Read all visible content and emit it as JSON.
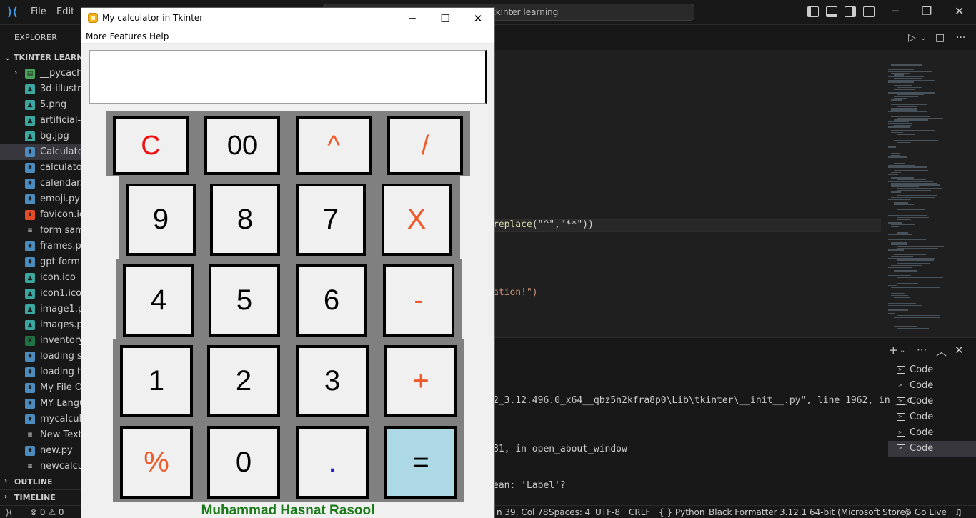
{
  "vscode": {
    "menu": [
      "File",
      "Edit"
    ],
    "command_center_text": "tkinter learning",
    "sidebar": {
      "title": "EXPLORER",
      "folder": "TKINTER LEARNING",
      "files": [
        {
          "label": "__pycache__",
          "type": "folder"
        },
        {
          "label": "3d-illustrat",
          "type": "image"
        },
        {
          "label": "5.png",
          "type": "image"
        },
        {
          "label": "artificial-In",
          "type": "image"
        },
        {
          "label": "bg.jpg",
          "type": "image"
        },
        {
          "label": "Calculator.p",
          "type": "python",
          "selected": true
        },
        {
          "label": "calculator.p",
          "type": "python"
        },
        {
          "label": "calendar.py",
          "type": "python"
        },
        {
          "label": "emoji.py",
          "type": "python"
        },
        {
          "label": "favicon.ico",
          "type": "star"
        },
        {
          "label": "form samp",
          "type": "text"
        },
        {
          "label": "frames.py",
          "type": "python"
        },
        {
          "label": "gpt form .p",
          "type": "python"
        },
        {
          "label": "icon.ico",
          "type": "image"
        },
        {
          "label": "icon1.ico",
          "type": "image"
        },
        {
          "label": "image1.pn",
          "type": "image"
        },
        {
          "label": "images.pn",
          "type": "image"
        },
        {
          "label": "inventory.x",
          "type": "excel"
        },
        {
          "label": "loading scr",
          "type": "python"
        },
        {
          "label": "loading tru",
          "type": "python"
        },
        {
          "label": "My File Or",
          "type": "python"
        },
        {
          "label": "MY Langu",
          "type": "python"
        },
        {
          "label": "mycalcula",
          "type": "python"
        },
        {
          "label": "New Text",
          "type": "text"
        },
        {
          "label": "new.py",
          "type": "python"
        },
        {
          "label": "newcalcul",
          "type": "text"
        }
      ],
      "sections": [
        "OUTLINE",
        "TIMELINE"
      ]
    },
    "editor": {
      "line1_fn": "replace",
      "line1_args": "(\"^\",\"**\")",
      "line1_close": ")",
      "line2": "ation!\")"
    },
    "terminal": {
      "lines": [
        "2_3.12.496.0_x64__qbz5n2kfra8p0\\Lib\\tkinter\\__init__.py\", line 1962, in __c",
        "81, in open_about_window",
        "ean: 'Label'?"
      ],
      "tabs": [
        "Code",
        "Code",
        "Code",
        "Code",
        "Code",
        "Code"
      ]
    },
    "status": {
      "problems": "⊗ 0 ⚠ 0",
      "position": "n 39, Col 78",
      "spaces": "Spaces: 4",
      "encoding": "UTF-8",
      "eol": "CRLF",
      "language": "{ } Python",
      "formatter": "Black Formatter",
      "interpreter": "3.12.1 64-bit (Microsoft Store)",
      "live": "Go Live"
    }
  },
  "tk": {
    "title": "My calculator in Tkinter",
    "menu": [
      "More Features",
      "Help"
    ],
    "display_value": "",
    "footer": "Muhammad Hasnat Rasool",
    "colors": {
      "red": "#ee1111",
      "orange": "#f05a2a",
      "blue": "#1a1acc",
      "equals_bg": "#add8e6"
    },
    "rows": [
      [
        {
          "label": "C",
          "color": "red"
        },
        {
          "label": "00",
          "color": "black"
        },
        {
          "label": "^",
          "color": "orange"
        },
        {
          "label": "/",
          "color": "orange"
        }
      ],
      [
        {
          "label": "9",
          "color": "black"
        },
        {
          "label": "8",
          "color": "black"
        },
        {
          "label": "7",
          "color": "black"
        },
        {
          "label": "X",
          "color": "orange"
        }
      ],
      [
        {
          "label": "4",
          "color": "black"
        },
        {
          "label": "5",
          "color": "black"
        },
        {
          "label": "6",
          "color": "black"
        },
        {
          "label": "-",
          "color": "orange"
        }
      ],
      [
        {
          "label": "1",
          "color": "black"
        },
        {
          "label": "2",
          "color": "black"
        },
        {
          "label": "3",
          "color": "black"
        },
        {
          "label": "+",
          "color": "orange"
        }
      ],
      [
        {
          "label": "%",
          "color": "orange"
        },
        {
          "label": "0",
          "color": "black"
        },
        {
          "label": ".",
          "color": "blue"
        },
        {
          "label": "=",
          "color": "black"
        }
      ]
    ]
  }
}
